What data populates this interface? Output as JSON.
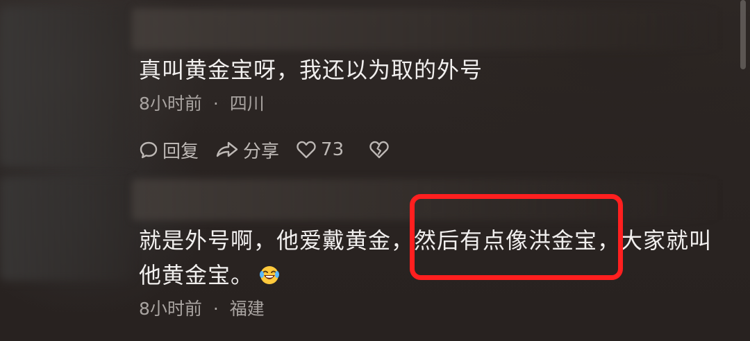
{
  "comments": [
    {
      "text": "真叫黄金宝呀，我还以为取的外号",
      "time": "8小时前",
      "separator": "·",
      "location": "四川",
      "actions": {
        "reply_label": "回复",
        "share_label": "分享",
        "like_count": "73"
      }
    },
    {
      "line1": "就是外号啊，他爱戴黄金，然后有点像洪金宝，大家就叫",
      "line2": "他黄金宝。",
      "emoji": "laughing-tears-emoji",
      "time": "8小时前",
      "separator": "·",
      "location": "福建"
    }
  ],
  "colors": {
    "highlight": "#ff1f1f",
    "text": "#f1efee",
    "meta": "#a9a4a1"
  }
}
